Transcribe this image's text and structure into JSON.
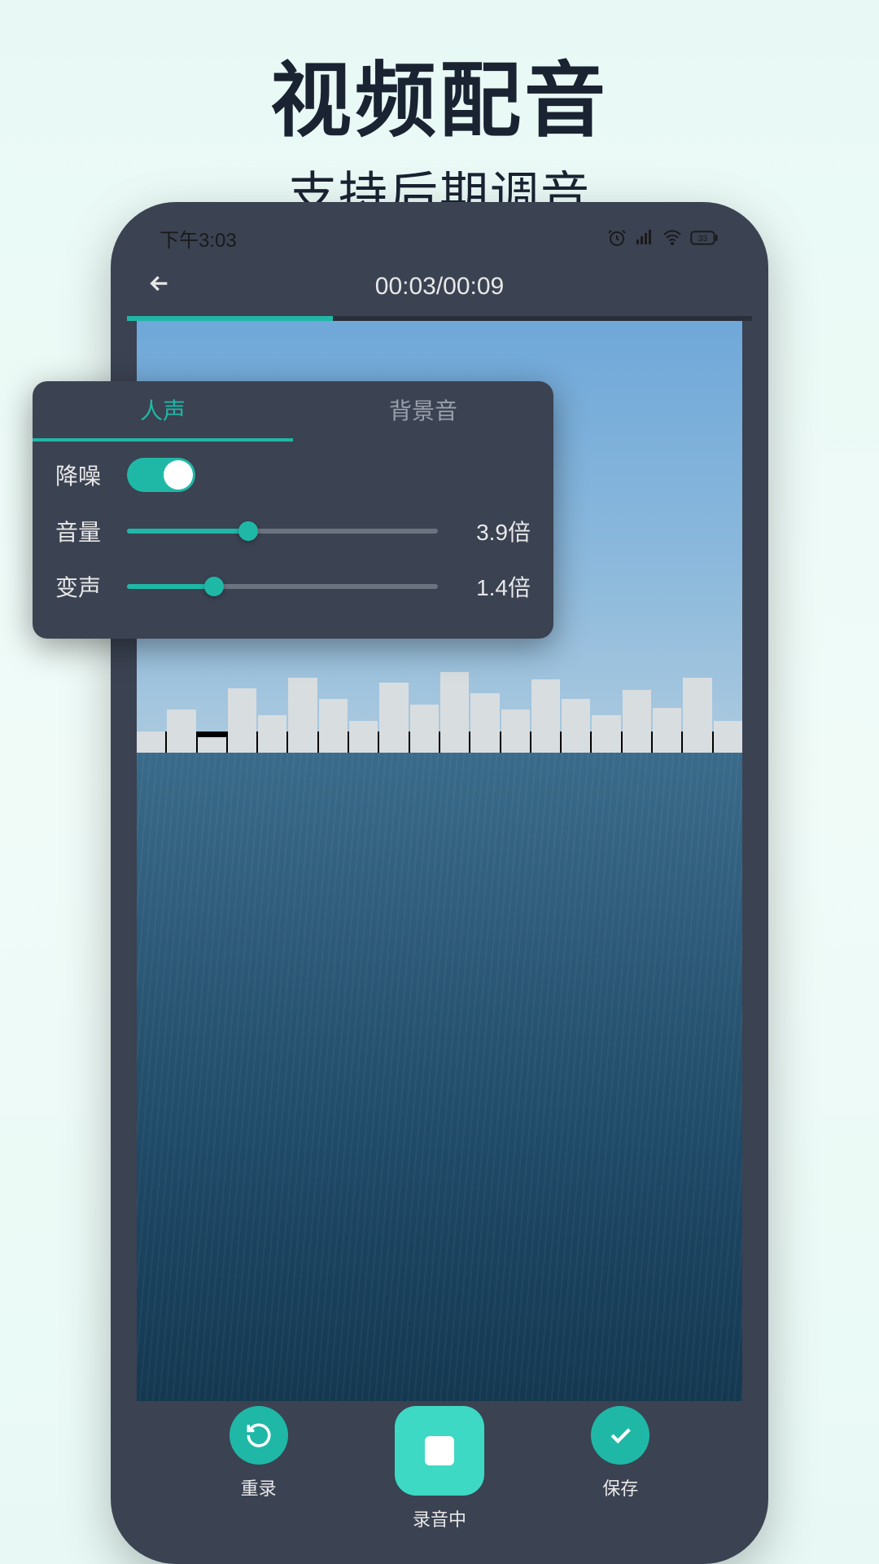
{
  "promo": {
    "title": "视频配音",
    "subtitle": "支持后期调音"
  },
  "status": {
    "time": "下午3:03",
    "battery": "33"
  },
  "header": {
    "timestamp": "00:03/00:09"
  },
  "panel": {
    "tabs": {
      "voice": "人声",
      "bgm": "背景音"
    },
    "rows": {
      "noise": {
        "label": "降噪"
      },
      "volume": {
        "label": "音量",
        "value": "3.9倍",
        "percent": 39
      },
      "pitch": {
        "label": "变声",
        "value": "1.4倍",
        "percent": 28
      }
    }
  },
  "controls": {
    "redo": "重录",
    "recording": "录音中",
    "save": "保存"
  }
}
